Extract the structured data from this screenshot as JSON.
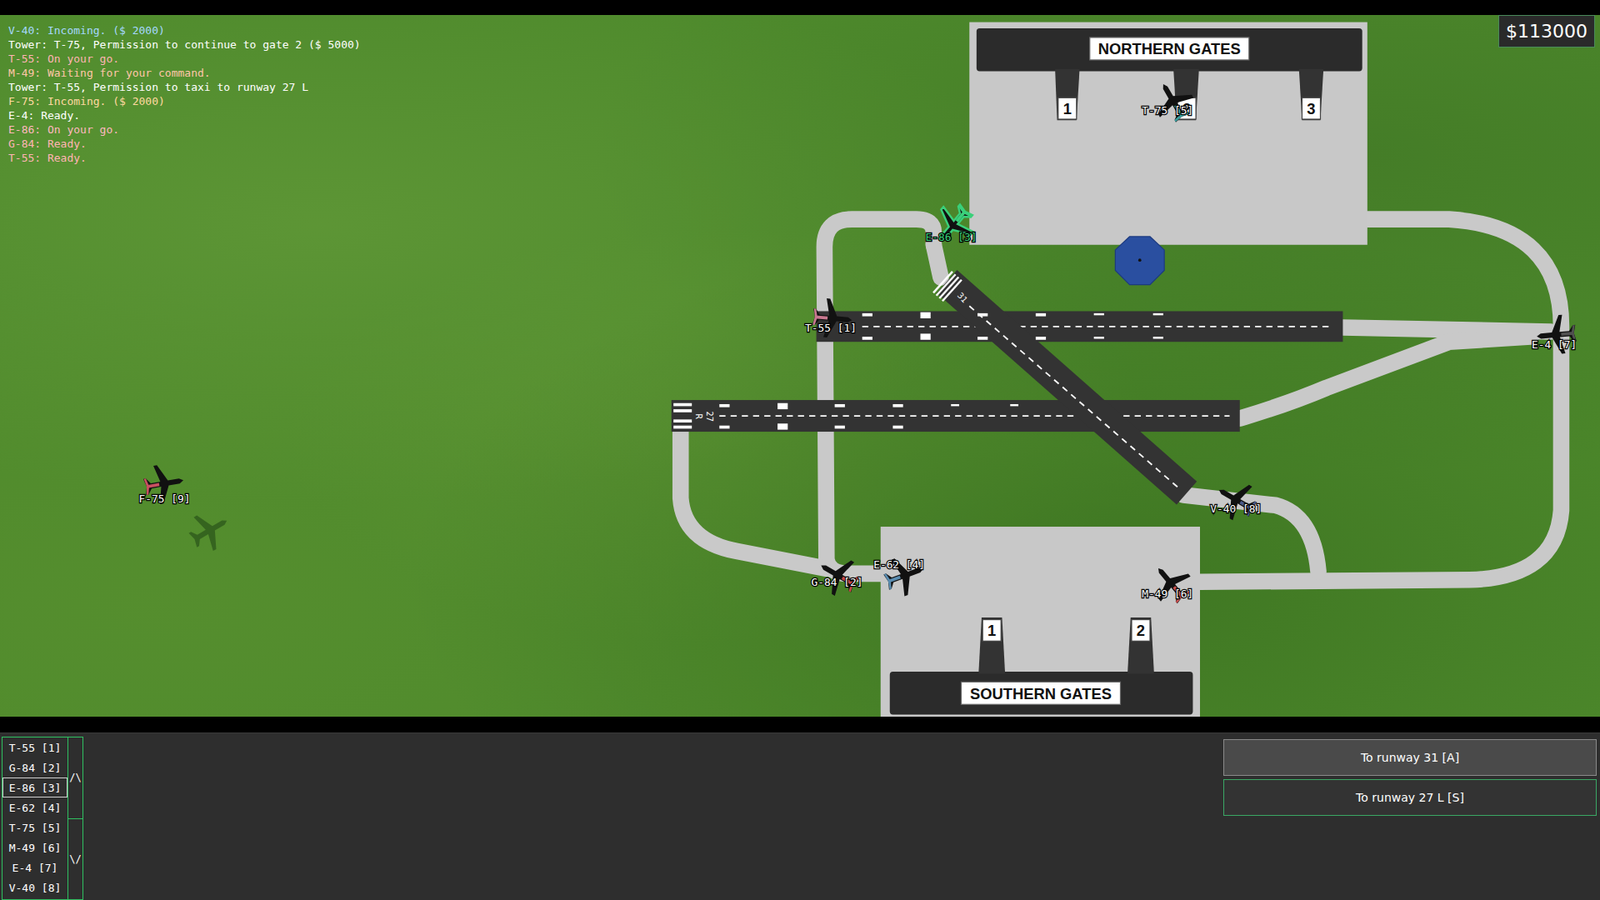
{
  "money": "$113000",
  "log": [
    {
      "text": "V-40: Incoming. ($ 2000)",
      "color": "#a6d8ff"
    },
    {
      "text": "Tower: T-75, Permission to continue to gate 2 ($ 5000)",
      "color": "#ffffff"
    },
    {
      "text": "T-55: On your go.",
      "color": "#ffb4b4"
    },
    {
      "text": "M-49: Waiting for your command.",
      "color": "#ffc6a8"
    },
    {
      "text": "Tower: T-55, Permission to taxi to runway 27 L",
      "color": "#ffffff"
    },
    {
      "text": "F-75: Incoming. ($ 2000)",
      "color": "#ffd9a0"
    },
    {
      "text": "E-4: Ready.",
      "color": "#ffffff"
    },
    {
      "text": "E-86: On your go.",
      "color": "#ffb8c0"
    },
    {
      "text": "G-84: Ready.",
      "color": "#ffb4b4"
    },
    {
      "text": "T-55: Ready.",
      "color": "#ffb4b4"
    }
  ],
  "terminals": [
    {
      "name": "NORTHERN GATES",
      "gates": [
        "1",
        "2",
        "3"
      ]
    },
    {
      "name": "SOUTHERN GATES",
      "gates": [
        "1",
        "2"
      ]
    }
  ],
  "runway_markings": [
    "31",
    "27",
    "R"
  ],
  "aircraft": [
    {
      "label": "T-55 [1]",
      "color": "#c87890",
      "selected": false
    },
    {
      "label": "G-84 [2]",
      "color": "#c84848",
      "selected": false
    },
    {
      "label": "E-86 [3]",
      "color": "#3ad07a",
      "selected": true
    },
    {
      "label": "E-62 [4]",
      "color": "#5a8cb0",
      "selected": false
    },
    {
      "label": "T-75 [5]",
      "color": "#3aa0a0",
      "selected": false
    },
    {
      "label": "M-49 [6]",
      "color": "#c85050",
      "selected": false
    },
    {
      "label": "E-4 [7]",
      "color": "#505050",
      "selected": false
    },
    {
      "label": "V-40 [8]",
      "color": "#4a5a8a",
      "selected": false
    },
    {
      "label": "F-75 [9]",
      "color": "#c85060",
      "selected": false
    }
  ],
  "scroll_buttons": [
    "/\\",
    "\\/"
  ],
  "commands": [
    {
      "label": "To runway 31 [A]",
      "highlighted": true
    },
    {
      "label": "To runway 27 L [S]",
      "highlighted": false
    }
  ]
}
